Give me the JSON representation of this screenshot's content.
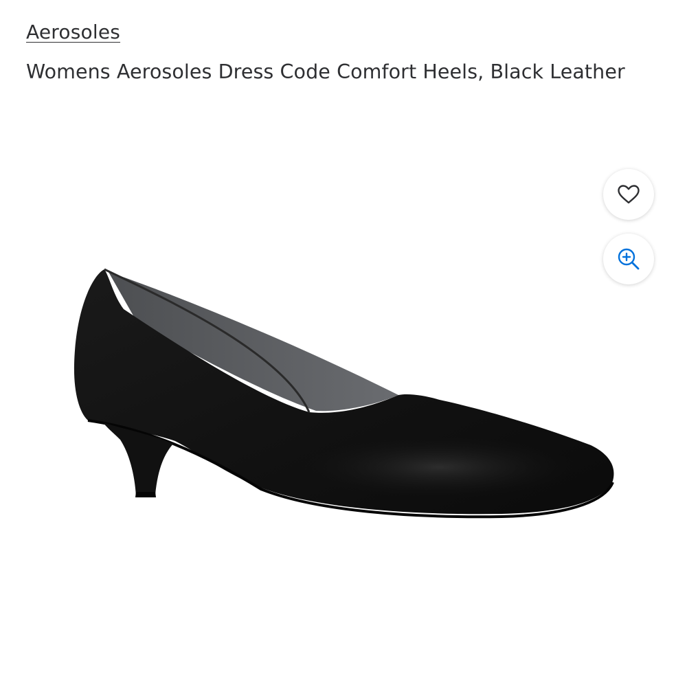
{
  "brand": {
    "label": "Aerosoles"
  },
  "product": {
    "title": "Womens Aerosoles Dress Code Comfort Heels, Black Leather"
  },
  "image": {
    "alt": "Womens Aerosoles Dress Code Comfort Heels, Black Leather"
  },
  "actions": {
    "favorite_icon": "heart-icon",
    "zoom_icon": "zoom-in-icon"
  },
  "colors": {
    "text": "#2e2f32",
    "zoom_icon": "#0071dc",
    "heart_icon": "#2e2f32",
    "shoe": "#151515"
  }
}
